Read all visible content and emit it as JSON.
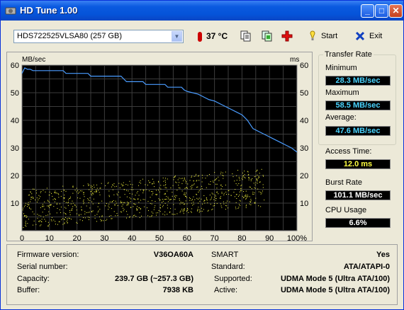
{
  "window": {
    "title": "HD Tune 1.00",
    "minimize": "_",
    "maximize": "□",
    "close": "✕"
  },
  "toolbar": {
    "drive": "HDS722525VLSA80 (257 GB)",
    "temperature": "37 °C",
    "start_label": "Start",
    "exit_label": "Exit"
  },
  "chart_data": {
    "type": "line",
    "left_axis_label": "MB/sec",
    "right_axis_label": "ms",
    "y_ticks": [
      "60",
      "50",
      "40",
      "30",
      "20",
      "10"
    ],
    "x_ticks": [
      "0",
      "10",
      "20",
      "30",
      "40",
      "50",
      "60",
      "70",
      "80",
      "90",
      "100%"
    ],
    "ylim": [
      0,
      60
    ],
    "xlim": [
      0,
      100
    ],
    "grid": true,
    "series": [
      {
        "type": "line",
        "color": "#4a9cff",
        "x": [
          0,
          1,
          2,
          3,
          4,
          15,
          16,
          24,
          25,
          36,
          37,
          38,
          39,
          44,
          45,
          52,
          53,
          58,
          59,
          60,
          62,
          64,
          65,
          66,
          68,
          70,
          72,
          74,
          75,
          76,
          78,
          80,
          82,
          84,
          86,
          88,
          90,
          92,
          94,
          96,
          98,
          100
        ],
        "y": [
          57,
          59,
          58.5,
          58.5,
          58,
          58,
          57,
          57,
          56,
          56,
          55,
          54,
          54,
          54,
          53,
          53,
          52,
          52,
          51,
          50.5,
          50,
          49.5,
          49,
          48.5,
          47.5,
          47,
          46,
          45,
          44.5,
          44,
          43,
          42,
          40,
          37,
          36,
          35,
          34,
          33,
          32,
          31,
          30,
          28.5
        ]
      }
    ],
    "access_scatter": {
      "color": "#ffff40",
      "x_range": [
        0,
        100
      ],
      "y_start_range": [
        1,
        15
      ],
      "y_end_range": [
        10,
        24
      ]
    }
  },
  "transfer": {
    "group_label": "Transfer Rate",
    "min_label": "Minimum",
    "min_value": "28.3 MB/sec",
    "max_label": "Maximum",
    "max_value": "58.5 MB/sec",
    "avg_label": "Average:",
    "avg_value": "47.6 MB/sec",
    "access_label": "Access Time:",
    "access_value": "12.0 ms",
    "burst_label": "Burst Rate",
    "burst_value": "101.1 MB/sec",
    "cpu_label": "CPU Usage",
    "cpu_value": "6.6%"
  },
  "info": {
    "firmware_label": "Firmware version:",
    "firmware": "V36OA60A",
    "serial_label": "Serial number:",
    "capacity_label": "Capacity:",
    "capacity": "239.7 GB (~257.3 GB)",
    "buffer_label": "Buffer:",
    "buffer": "7938 KB",
    "smart_label": "SMART",
    "smart": "Yes",
    "standard_label": "Standard:",
    "standard": "ATA/ATAPI-0",
    "supported_label": "Supported:",
    "supported": "UDMA Mode 5 (Ultra ATA/100)",
    "active_label": "Active:",
    "active": "UDMA Mode 5 (Ultra ATA/100)"
  }
}
